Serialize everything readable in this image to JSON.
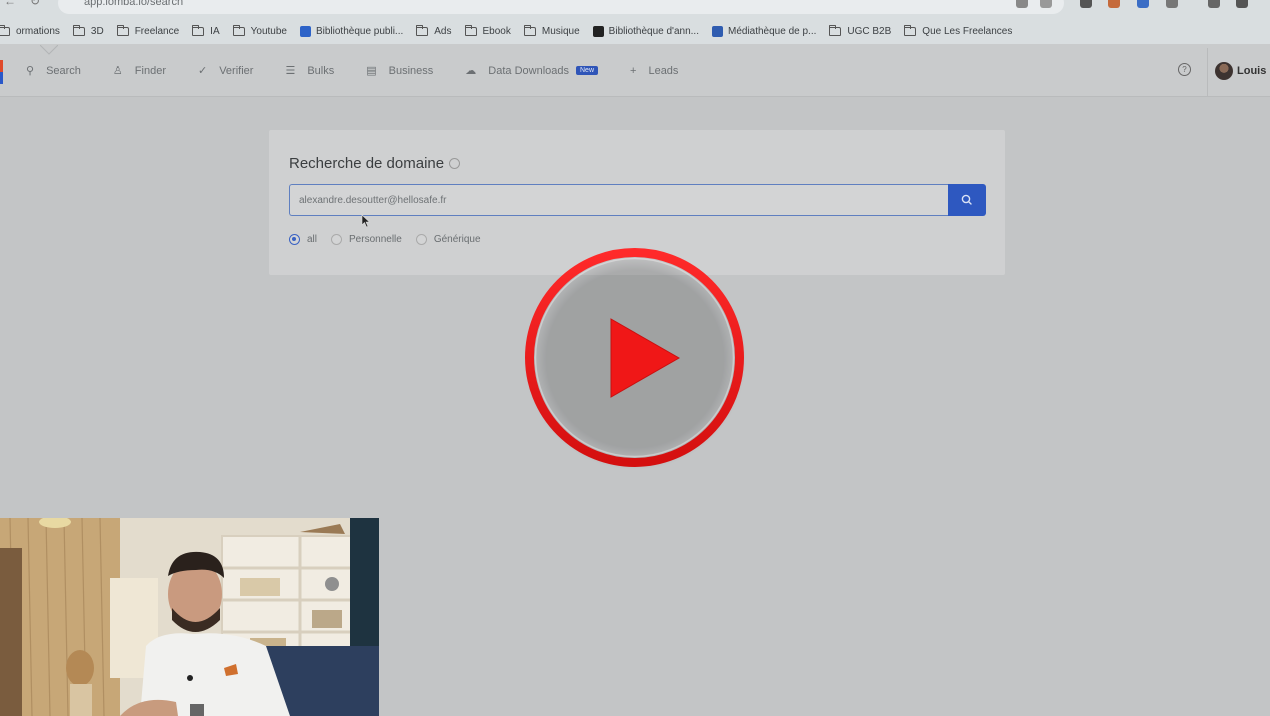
{
  "browser": {
    "url": "app.lomba.io/search",
    "bookmarks": [
      {
        "label": "ormations",
        "icon": "folder-icon"
      },
      {
        "label": "3D",
        "icon": "folder-icon"
      },
      {
        "label": "Freelance",
        "icon": "folder-icon"
      },
      {
        "label": "IA",
        "icon": "folder-icon"
      },
      {
        "label": "Youtube",
        "icon": "folder-icon"
      },
      {
        "label": "Bibliothèque publi...",
        "icon": "meta-icon",
        "color": "#2d63c8"
      },
      {
        "label": "Ads",
        "icon": "folder-icon"
      },
      {
        "label": "Ebook",
        "icon": "folder-icon"
      },
      {
        "label": "Musique",
        "icon": "folder-icon"
      },
      {
        "label": "Bibliothèque d'ann...",
        "icon": "tiktok-icon",
        "color": "#222222"
      },
      {
        "label": "Médiathèque de p...",
        "icon": "linkedin-icon",
        "color": "#2f5cb0"
      },
      {
        "label": "UGC B2B",
        "icon": "folder-icon"
      },
      {
        "label": "Que Les Freelances",
        "icon": "folder-icon"
      }
    ]
  },
  "nav": {
    "items": [
      {
        "label": "Search",
        "icon": "search-icon",
        "glyph": "⚲"
      },
      {
        "label": "Finder",
        "icon": "person-icon",
        "glyph": "♙"
      },
      {
        "label": "Verifier",
        "icon": "check-icon",
        "glyph": "✓"
      },
      {
        "label": "Bulks",
        "icon": "list-icon",
        "glyph": "☰"
      },
      {
        "label": "Business",
        "icon": "calendar-icon",
        "glyph": "▤"
      },
      {
        "label": "Data Downloads",
        "icon": "cloud-icon",
        "glyph": "☁",
        "badge": "New"
      },
      {
        "label": "Leads",
        "icon": "plus-icon",
        "glyph": "+"
      }
    ]
  },
  "user": {
    "name": "Louis"
  },
  "card": {
    "title": "Recherche de domaine",
    "input_value": "alexandre.desoutter@hellosafe.fr",
    "radios": [
      {
        "label": "all",
        "checked": true
      },
      {
        "label": "Personnelle",
        "checked": false
      },
      {
        "label": "Générique",
        "checked": false
      }
    ]
  },
  "colors": {
    "accent": "#2e58c0",
    "play_red": "#e61919",
    "brand_orange": "#e04a2a"
  }
}
